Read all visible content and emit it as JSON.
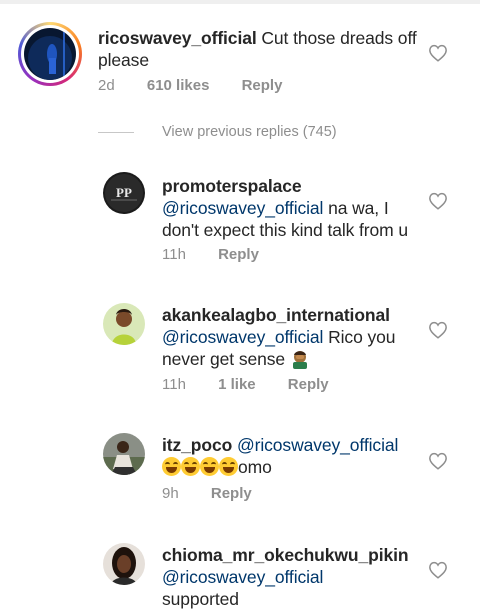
{
  "comments": [
    {
      "username": "ricoswavey_official",
      "text": "Cut those dreads off please",
      "time": "2d",
      "likes": "610 likes",
      "reply": "Reply"
    },
    {
      "username": "promoterspalace",
      "mention": "@ricoswavey_official",
      "text": " na wa, I don't expect this kind talk from u",
      "time": "11h",
      "reply": "Reply"
    },
    {
      "username": "akankealagbo_international",
      "mention": "@ricoswavey_official",
      "text": " Rico you never get sense ",
      "time": "11h",
      "likes": "1 like",
      "reply": "Reply"
    },
    {
      "username": "itz_poco",
      "mention": "@ricoswavey_official",
      "text": "omo",
      "time": "9h",
      "reply": "Reply"
    },
    {
      "username": "chioma_mr_okechukwu_pikin",
      "mention": "@ricoswavey_official",
      "text": "supported"
    }
  ],
  "view_previous": "View previous replies (745)",
  "colors": {
    "mention": "#00376b",
    "meta": "#8e8e8e",
    "username": "#262626"
  },
  "icons": {
    "like": "heart-outline-icon"
  }
}
